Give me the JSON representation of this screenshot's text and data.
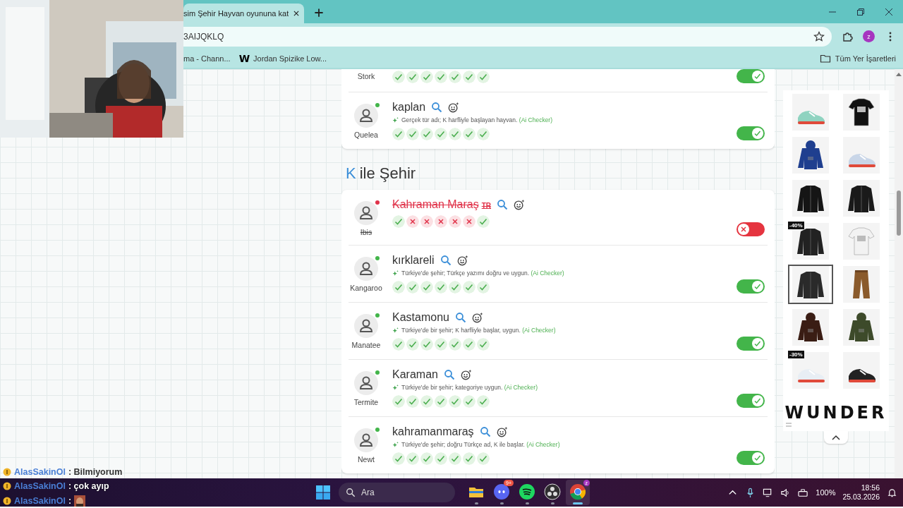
{
  "browser": {
    "tab": {
      "title": "sim Şehir Hayvan oyununa kat"
    },
    "address": "3AIJQKLQ",
    "profile_initial": "z",
    "bookmarks": [
      {
        "label": "ma - Chann..."
      },
      {
        "label": "Jordan Spizike Low...",
        "icon_text": "W"
      }
    ],
    "all_bookmarks": "Tüm Yer İşaretleri"
  },
  "groups": [
    {
      "entries": [
        {
          "player": "Stork",
          "votes": [
            true,
            true,
            true,
            true,
            true,
            true,
            true
          ],
          "approved": true
        },
        {
          "player": "Quelea",
          "online": true,
          "valid": true,
          "answer": "kaplan",
          "note": "Gerçek tür adı; K harfliyle başlayan hayvan.",
          "checker": "(Ai Checker)",
          "votes": [
            true,
            true,
            true,
            true,
            true,
            true,
            true
          ],
          "approved": true
        }
      ]
    },
    {
      "letter": "K",
      "title": "ile Şehir",
      "entries": [
        {
          "player": "Ibis",
          "online": true,
          "valid": false,
          "answer": "Kahraman Maraş",
          "tag": "TR",
          "votes": [
            true,
            false,
            false,
            false,
            false,
            false,
            true
          ],
          "approved": false
        },
        {
          "player": "Kangaroo",
          "online": true,
          "valid": true,
          "answer": "kırklareli",
          "note": "Türkiye'de şehir; Türkçe yazımı doğru ve uygun.",
          "checker": "(Ai Checker)",
          "votes": [
            true,
            true,
            true,
            true,
            true,
            true,
            true
          ],
          "approved": true
        },
        {
          "player": "Manatee",
          "online": true,
          "valid": true,
          "answer": "Kastamonu",
          "note": "Türkiye'de bir şehir; K harfliyle başlar, uygun.",
          "checker": "(Ai Checker)",
          "votes": [
            true,
            true,
            true,
            true,
            true,
            true,
            true
          ],
          "approved": true
        },
        {
          "player": "Termite",
          "online": true,
          "valid": true,
          "answer": "Karaman",
          "note": "Türkiye'de bir şehir; kategoriye uygun.",
          "checker": "(Ai Checker)",
          "votes": [
            true,
            true,
            true,
            true,
            true,
            true,
            true
          ],
          "approved": true
        },
        {
          "player": "Newt",
          "online": true,
          "valid": true,
          "answer": "kahramanmaraş",
          "note": "Türkiye'de şehir; doğru Türkçe ad, K ile başlar.",
          "checker": "(Ai Checker)",
          "votes": [
            true,
            true,
            true,
            true,
            true,
            true,
            true
          ],
          "approved": true
        }
      ]
    }
  ],
  "ads": {
    "products": [
      {
        "selected": false
      },
      {
        "selected": false
      },
      {
        "selected": false
      },
      {
        "selected": false
      },
      {
        "selected": false
      },
      {
        "selected": false
      },
      {
        "selected": false,
        "badge": "-40%"
      },
      {
        "selected": false
      },
      {
        "selected": true
      },
      {
        "selected": false
      },
      {
        "selected": false
      },
      {
        "selected": false
      },
      {
        "selected": false,
        "badge": "-30%"
      },
      {
        "selected": false
      }
    ],
    "brand": "WUNDER"
  },
  "chat": [
    {
      "user": "AlasSakinOl",
      "message": ": Bilmiyorum"
    },
    {
      "user": "AlasSakinOl",
      "message": ": çok ayıp"
    },
    {
      "user": "AlasSakinOl",
      "message": ":",
      "kind": "emote"
    }
  ],
  "taskbar": {
    "search": "Ara",
    "apps": [
      {
        "kind": "files",
        "selected": false
      },
      {
        "kind": "discord",
        "badge": "9+",
        "selected": false
      },
      {
        "kind": "spotify",
        "selected": false
      },
      {
        "kind": "obs",
        "selected": false
      },
      {
        "kind": "chrome",
        "badge": "z",
        "selected": true
      }
    ],
    "battery": "100%",
    "time": "18:56",
    "date": "25.03.2026"
  }
}
